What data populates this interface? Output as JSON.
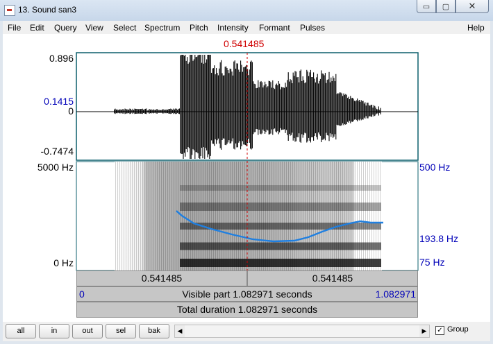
{
  "window": {
    "title": "13. Sound san3",
    "min_glyph": "▭",
    "max_glyph": "▢",
    "close_glyph": "✕"
  },
  "menu": [
    "File",
    "Edit",
    "Query",
    "View",
    "Select",
    "Spectrum",
    "Pitch",
    "Intensity",
    "Formant",
    "Pulses",
    "Help"
  ],
  "cursor_time": "0.541485",
  "waveform": {
    "max": "0.896",
    "cursor_value": "0.1415",
    "zero": "0",
    "min": "-0.7474"
  },
  "spectrogram": {
    "top_freq": "5000 Hz",
    "bottom_freq": "0 Hz"
  },
  "pitch": {
    "top": "500 Hz",
    "cursor_value": "193.8 Hz",
    "bottom": "75 Hz"
  },
  "selection_bar": {
    "left": "0.541485",
    "right": "0.541485"
  },
  "visible_bar": {
    "start": "0",
    "label": "Visible part 1.082971 seconds",
    "end": "1.082971"
  },
  "total_bar": {
    "label": "Total duration 1.082971 seconds"
  },
  "buttons": {
    "all": "all",
    "in": "in",
    "out": "out",
    "sel": "sel",
    "bak": "bak"
  },
  "group": {
    "label": "Group",
    "checked": true,
    "check_glyph": "✓"
  },
  "colors": {
    "cursor": "#d00000",
    "pitch_curve": "#1f7fe0",
    "axis_label_secondary": "#0000b8",
    "frame": "#0c5f6c"
  }
}
